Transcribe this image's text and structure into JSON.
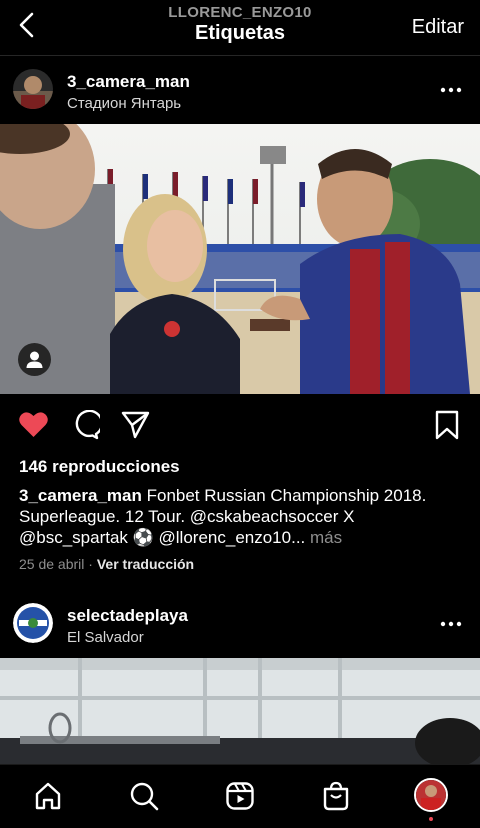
{
  "header": {
    "back_icon": "chevron-left-icon",
    "subtitle": "LLORENC_ENZO10",
    "title": "Etiquetas",
    "edit_label": "Editar"
  },
  "post1": {
    "username": "3_camera_man",
    "location": "Стадион Янтарь",
    "more_icon": "more-horizontal-icon",
    "tag_icon": "user-tag-icon",
    "liked": true,
    "like_color": "#ed4956",
    "views": "146 reproducciones",
    "caption_user": "3_camera_man",
    "caption_text": "Fonbet Russian Championship 2018. Superleague. 12 Tour. @cskabeachsoccer X @bsc_spartak ⚽ @llorenc_enzo10...",
    "caption_more": "más",
    "date": "25 de abril",
    "dot": "·",
    "translate": "Ver traducción"
  },
  "post2": {
    "username": "selectadeplaya",
    "location": "El Salvador",
    "more_icon": "more-horizontal-icon"
  },
  "tabbar": {
    "items": [
      "home-icon",
      "search-icon",
      "reels-icon",
      "shop-icon",
      "profile-avatar"
    ]
  }
}
